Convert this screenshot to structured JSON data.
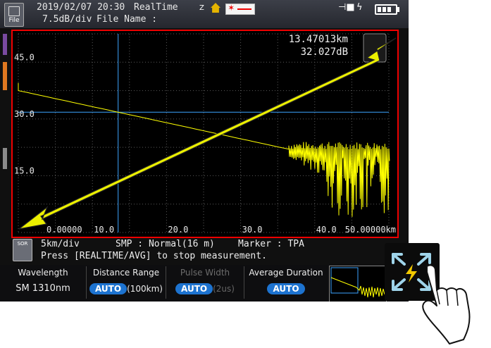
{
  "header": {
    "file_label": "File",
    "datetime": "2019/02/07 20:30",
    "mode": "RealTime",
    "scale": "7.5dB/div",
    "file_name_label": "File Name :",
    "home_label": "Z"
  },
  "trace": {
    "cursor_distance": "13.47013km",
    "cursor_loss": "32.027dB",
    "y_ticks": [
      {
        "label": "45.0",
        "value": 45
      },
      {
        "label": "30.0",
        "value": 30
      },
      {
        "label": "15.0",
        "value": 15
      }
    ],
    "x_ticks": [
      {
        "label": "0.00000",
        "value": 0
      },
      {
        "label": "10.0",
        "value": 10
      },
      {
        "label": "20.0",
        "value": 20
      },
      {
        "label": "30.0",
        "value": 30
      },
      {
        "label": "40.0",
        "value": 40
      },
      {
        "label": "50.00000km",
        "value": 50
      }
    ],
    "x_range_km": [
      0,
      50
    ],
    "y_range_db": [
      0,
      52.5
    ],
    "cursor_km": 13.47,
    "trace_start_db": 37.5,
    "noise_start_km": 36.5,
    "trace_color": "#ffff00",
    "cursor_color": "#3da5ff",
    "grid": true
  },
  "status": {
    "sor_label": "SOR",
    "km_per_div": "5km/div",
    "smp": "SMP : Normal(16 m)",
    "marker": "Marker : TPA",
    "message": "Press [REALTIME/AVG] to stop measurement."
  },
  "params": {
    "wavelength": {
      "label": "Wavelength",
      "value": "SM 1310nm"
    },
    "distance_range": {
      "label": "Distance Range",
      "value": "AUTO",
      "sub": "(100km)"
    },
    "pulse_width": {
      "label": "Pulse Width",
      "value": "AUTO",
      "sub": "(2us)"
    },
    "average_duration": {
      "label": "Average Duration",
      "value": "AUTO"
    }
  },
  "colors": {
    "annotation_arrow": "#ecf000",
    "highlight_border": "#ee0000",
    "pill": "#1d73d0",
    "zoom_arrows": "#9fd4ea"
  }
}
